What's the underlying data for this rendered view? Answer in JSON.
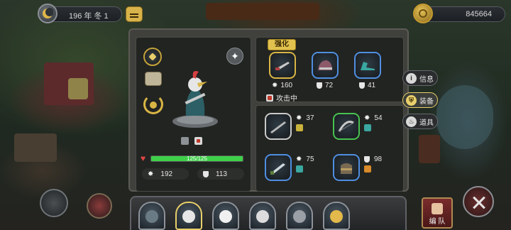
{
  "top_bar": {
    "date": "196 年 冬 1",
    "gold": "845664"
  },
  "panel": {
    "hero": {
      "hp_label": "125/125",
      "hp_fraction": 1.0,
      "attack": "192",
      "defense": "113"
    },
    "equipped": {
      "enhance_label": "强化",
      "items": [
        {
          "value": "160",
          "stat": "attack",
          "border": "#d9b545"
        },
        {
          "value": "72",
          "stat": "defense",
          "border": "#4f8ee0"
        },
        {
          "value": "41",
          "stat": "defense",
          "border": "#4f8ee0"
        }
      ],
      "status": "攻击中"
    },
    "inventory": [
      {
        "value": "37",
        "stat": "attack",
        "border": "#c9c9c9",
        "badge_color": "#c9b33a"
      },
      {
        "value": "54",
        "stat": "attack",
        "border": "#48c24f",
        "badge_color": "#3aa7a0"
      },
      {
        "value": "75",
        "stat": "attack",
        "border": "#4f8ee0",
        "badge_color": "#3aa7a0"
      },
      {
        "value": "98",
        "stat": "defense",
        "border": "#4f8ee0",
        "badge_color": "#d98a2a"
      }
    ]
  },
  "side_tabs": [
    {
      "label": "信息",
      "icon": "info-icon",
      "active": false
    },
    {
      "label": "装备",
      "icon": "equipment-icon",
      "active": true
    },
    {
      "label": "道具",
      "icon": "potion-icon",
      "active": false
    }
  ],
  "formation_label": "编 队",
  "colors": {
    "hp_green": "#3fd04a",
    "accent_gold": "#e8cf6b",
    "panel_bg": "#40403d"
  }
}
